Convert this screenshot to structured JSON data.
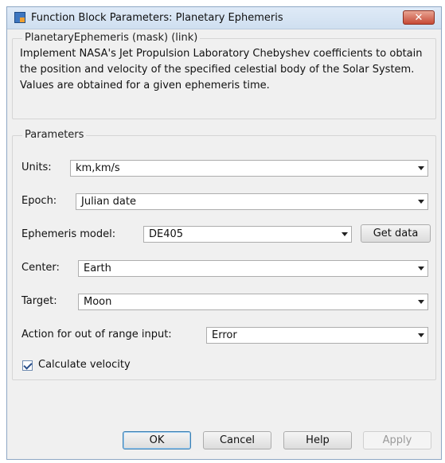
{
  "window": {
    "title": "Function Block Parameters: Planetary Ephemeris",
    "close_label": "✕"
  },
  "mask_group": {
    "title": "PlanetaryEphemeris (mask) (link)",
    "description": "Implement NASA's Jet Propulsion Laboratory Chebyshev coefficients to obtain the position and velocity of the specified celestial body of the Solar System. Values are obtained for a given ephemeris time."
  },
  "parameters": {
    "title": "Parameters",
    "units": {
      "label": "Units:",
      "value": "km,km/s"
    },
    "epoch": {
      "label": "Epoch:",
      "value": "Julian date"
    },
    "ephemeris_model": {
      "label": "Ephemeris model:",
      "value": "DE405",
      "get_data_label": "Get data"
    },
    "center": {
      "label": "Center:",
      "value": "Earth"
    },
    "target": {
      "label": "Target:",
      "value": "Moon"
    },
    "out_of_range": {
      "label": "Action for out of range input:",
      "value": "Error"
    },
    "calculate_velocity": {
      "label": "Calculate velocity",
      "checked": true
    }
  },
  "footer": {
    "ok": "OK",
    "cancel": "Cancel",
    "help": "Help",
    "apply": "Apply"
  }
}
